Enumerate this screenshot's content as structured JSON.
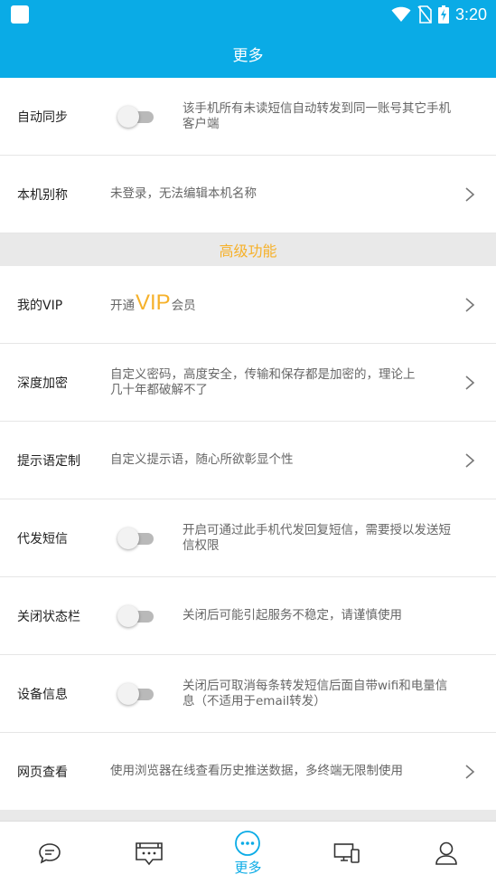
{
  "status_bar": {
    "time": "3:20"
  },
  "header": {
    "title": "更多"
  },
  "rows_top": [
    {
      "id": "auto-sync",
      "label": "自动同步",
      "toggle": false,
      "desc_lines": [
        "该手机所有未读短信自动转发到同一账号其它手机",
        "客户端"
      ]
    },
    {
      "id": "device-alias",
      "label": "本机别称",
      "desc_lines": [
        "未登录，无法编辑本机名称"
      ],
      "chevron": true
    }
  ],
  "section": {
    "title": "高级功能"
  },
  "vip_row": {
    "label": "我的VIP",
    "prefix": "开通",
    "highlight": "VIP",
    "suffix": "会员"
  },
  "rows_advanced": [
    {
      "id": "deep-encryption",
      "label": "深度加密",
      "desc_lines": [
        "自定义密码，高度安全，传输和保存都是加密的，理论上",
        "几十年都破解不了"
      ],
      "chevron": true
    },
    {
      "id": "prompt-custom",
      "label": "提示语定制",
      "desc_lines": [
        "自定义提示语，随心所欲彰显个性"
      ],
      "chevron": true
    },
    {
      "id": "proxy-sms",
      "label": "代发短信",
      "toggle": false,
      "desc_lines": [
        "开启可通过此手机代发回复短信，需要授以发送短",
        "信权限"
      ]
    },
    {
      "id": "close-statusbar",
      "label": "关闭状态栏",
      "toggle": false,
      "desc_lines": [
        "关闭后可能引起服务不稳定，请谨慎使用"
      ]
    },
    {
      "id": "device-info",
      "label": "设备信息",
      "toggle": false,
      "desc_lines": [
        "关闭后可取消每条转发短信后面自带wifi和电量信",
        "息（不适用于email转发）"
      ]
    },
    {
      "id": "web-view",
      "label": "网页查看",
      "desc_lines": [
        "使用浏览器在线查看历史推送数据，多终端无限制使用"
      ],
      "chevron": true
    }
  ],
  "tabbar": {
    "active_label": "更多",
    "tabs": [
      {
        "icon": "chat-bubble-icon"
      },
      {
        "icon": "messages-icon"
      },
      {
        "icon": "more-icon"
      },
      {
        "icon": "devices-icon"
      },
      {
        "icon": "user-icon"
      }
    ]
  },
  "colors": {
    "primary": "#0aabe6",
    "accent": "#f6b12a",
    "section_bg": "#e9e9e9",
    "toggle_off": "#b9b9b9"
  }
}
